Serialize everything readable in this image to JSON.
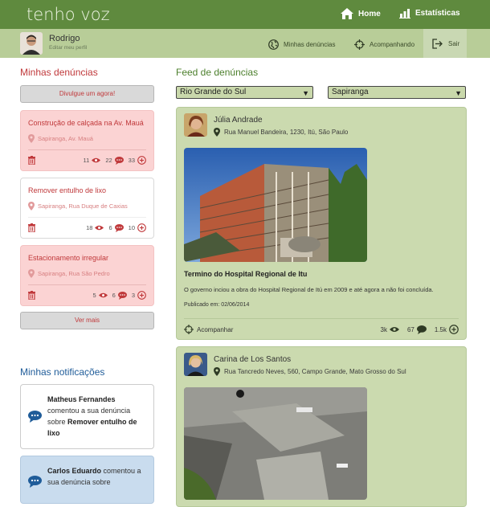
{
  "app": {
    "brand": "tenho voz"
  },
  "nav": {
    "home": "Home",
    "stats": "Estatísticas"
  },
  "user": {
    "name": "Rodrigo",
    "edit": "Editar meu perfil"
  },
  "subnav": {
    "mine": "Minhas denúncias",
    "following": "Acompanhando",
    "logout": "Sair"
  },
  "left": {
    "title": "Minhas denúncias",
    "cta": "Divulgue um agora!",
    "more": "Ver mais",
    "reports": [
      {
        "title": "Construção de calçada na Av. Mauá",
        "loc": "Sapiranga, Av. Mauá",
        "views": "11",
        "comments": "22",
        "follows": "33"
      },
      {
        "title": "Remover entulho de lixo",
        "loc": "Sapiranga, Rua Duque de Caxias",
        "views": "18",
        "comments": "6",
        "follows": "10"
      },
      {
        "title": "Estacionamento irregular",
        "loc": "Sapiranga, Rua São Pedro",
        "views": "5",
        "comments": "6",
        "follows": "3"
      }
    ]
  },
  "notifications": {
    "title": "Minhas notificações",
    "items": [
      {
        "who": "Matheus Fernandes",
        "text": " comentou a sua denúncia sobre ",
        "subject": "Remover entulho de lixo"
      },
      {
        "who": "Carlos Eduardo",
        "text": " comentou a sua denúncia sobre",
        "subject": ""
      }
    ]
  },
  "feed": {
    "title": "Feed de denúncias",
    "state": "Rio Grande do Sul",
    "city": "Sapiranga",
    "posts": [
      {
        "name": "Júlia Andrade",
        "address": "Rua Manuel Bandeira, 1230, Itú, São Paulo",
        "title": "Termino do Hospital Regional de Itu",
        "text": "O governo inciou a obra do Hospital Regional de Itú em 2009 e até agora a não foi concluída.",
        "date": "Publicado em: 02/06/2014",
        "follow": "Acompanhar",
        "views": "3k",
        "comments": "67",
        "follows": "1.5k"
      },
      {
        "name": "Carina de Los Santos",
        "address": "Rua Tancredo Neves, 560, Campo Grande, Mato Grosso do Sul"
      }
    ]
  },
  "colors": {
    "topbar": "#5f8a3e",
    "subbar": "#b8cd98",
    "accent_red": "#c0393b",
    "card_pink": "#fbd3d3",
    "feed_card": "#cbdaaf"
  }
}
